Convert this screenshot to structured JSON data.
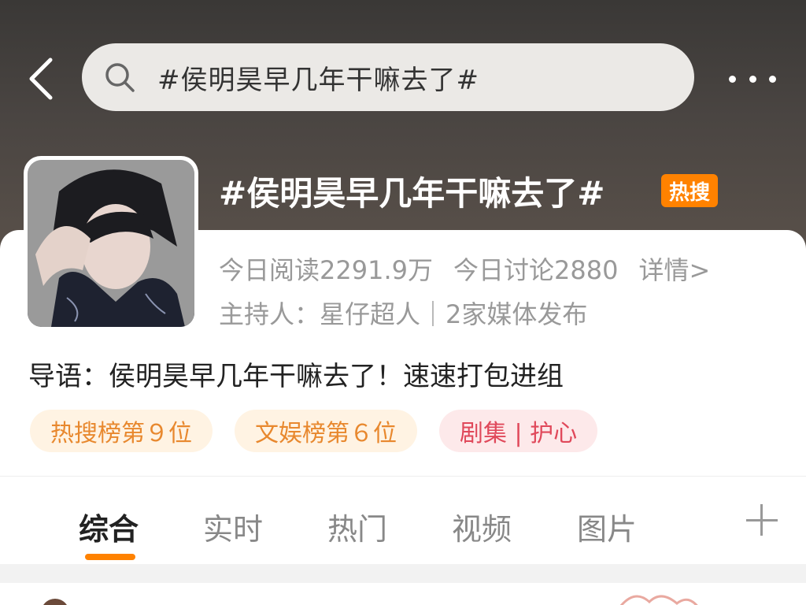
{
  "header": {
    "search_text": "#侯明昊早几年干嘛去了#"
  },
  "topic": {
    "title": "#侯明昊早几年干嘛去了#",
    "badge": "热搜",
    "reads": "今日阅读2291.9万",
    "discussions": "今日讨论2880",
    "detail_link": "详情>",
    "host_line": "主持人：星仔超人｜2家媒体发布",
    "guide": "导语：侯明昊早几年干嘛去了！速速打包进组",
    "tags": [
      {
        "label": "热搜榜第９位"
      },
      {
        "label": "文娱榜第６位"
      },
      {
        "label": "剧集 | 护心"
      }
    ]
  },
  "tabs": [
    {
      "label": "综合"
    },
    {
      "label": "实时"
    },
    {
      "label": "热门"
    },
    {
      "label": "视频"
    },
    {
      "label": "图片"
    }
  ],
  "colors": {
    "accent": "#ff8200",
    "tag_orange_text": "#e8882e",
    "tag_red_text": "#e0485a"
  }
}
